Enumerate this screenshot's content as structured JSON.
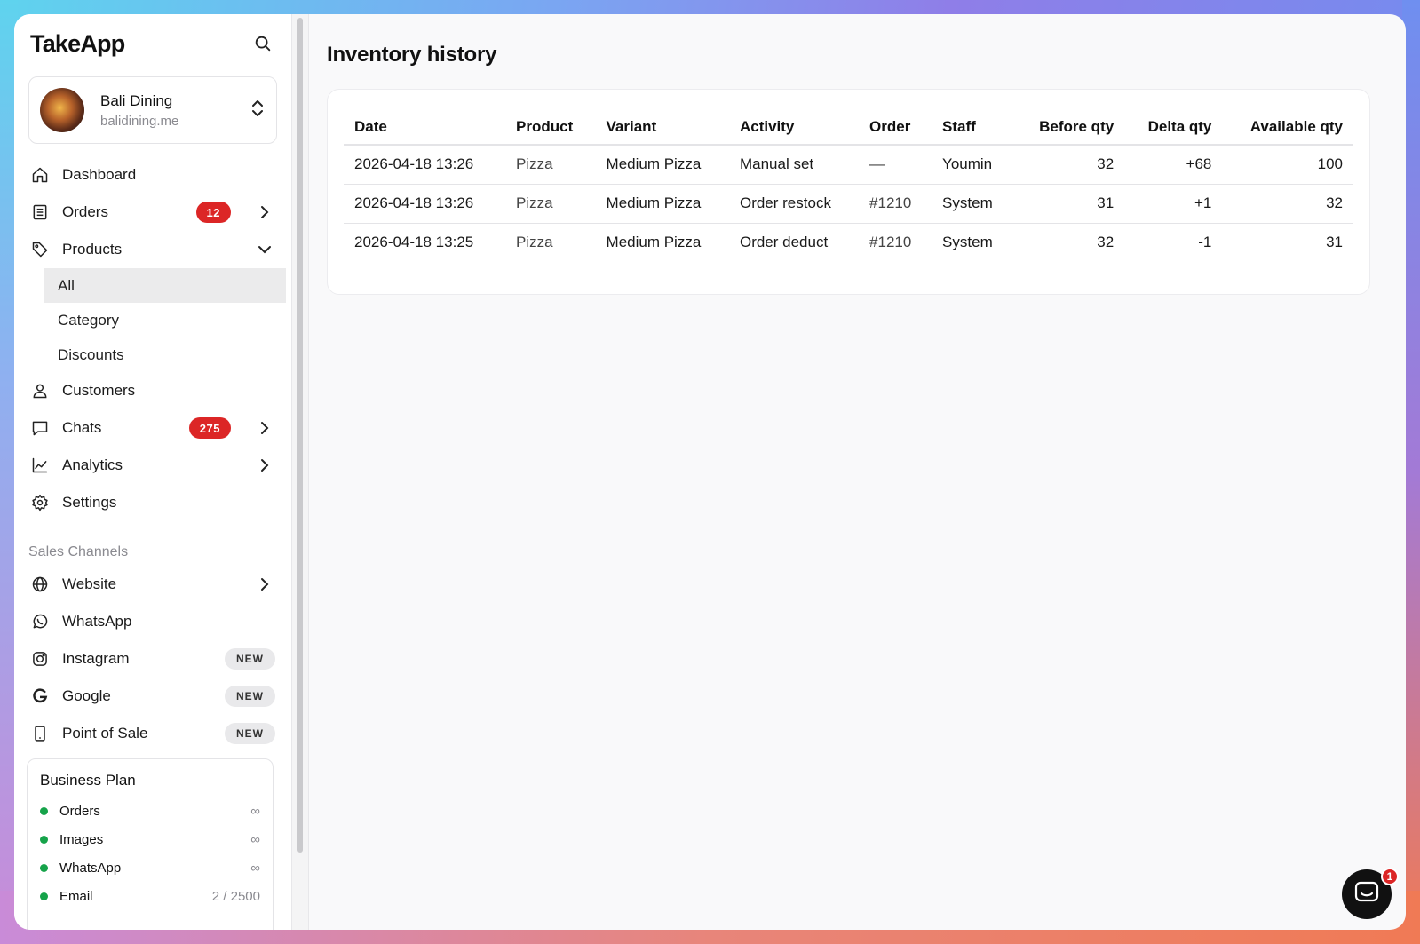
{
  "app": {
    "logo": "TakeApp"
  },
  "store": {
    "name": "Bali Dining",
    "domain": "balidining.me"
  },
  "nav": {
    "dashboard": "Dashboard",
    "orders": "Orders",
    "orders_badge": "12",
    "products": "Products",
    "products_sub": [
      "All",
      "Category",
      "Discounts"
    ],
    "customers": "Customers",
    "chats": "Chats",
    "chats_badge": "275",
    "analytics": "Analytics",
    "settings": "Settings"
  },
  "sales_channels": {
    "title": "Sales Channels",
    "items": [
      {
        "label": "Website",
        "icon": "globe-icon"
      },
      {
        "label": "WhatsApp",
        "icon": "whatsapp-icon"
      },
      {
        "label": "Instagram",
        "icon": "instagram-icon",
        "pill": "NEW"
      },
      {
        "label": "Google",
        "icon": "google-icon",
        "pill": "NEW"
      },
      {
        "label": "Point of Sale",
        "icon": "phone-icon",
        "pill": "NEW"
      }
    ]
  },
  "plan": {
    "title": "Business Plan",
    "rows": [
      {
        "name": "Orders",
        "value": "∞"
      },
      {
        "name": "Images",
        "value": "∞"
      },
      {
        "name": "WhatsApp",
        "value": "∞"
      },
      {
        "name": "Email",
        "value": "2 / 2500"
      }
    ]
  },
  "page": {
    "title": "Inventory history"
  },
  "table": {
    "headers": [
      "Date",
      "Product",
      "Variant",
      "Activity",
      "Order",
      "Staff",
      "Before qty",
      "Delta qty",
      "Available qty"
    ],
    "rows": [
      [
        "2026-04-18 13:26",
        "Pizza",
        "Medium Pizza",
        "Manual set",
        "—",
        "Youmin",
        "32",
        "+68",
        "100"
      ],
      [
        "2026-04-18 13:26",
        "Pizza",
        "Medium Pizza",
        "Order restock",
        "#1210",
        "System",
        "31",
        "+1",
        "32"
      ],
      [
        "2026-04-18 13:25",
        "Pizza",
        "Medium Pizza",
        "Order deduct",
        "#1210",
        "System",
        "32",
        "-1",
        "31"
      ]
    ]
  },
  "chat_widget": {
    "badge": "1"
  },
  "colors": {
    "badge": "#dc2626",
    "status_dot": "#16a34a"
  }
}
